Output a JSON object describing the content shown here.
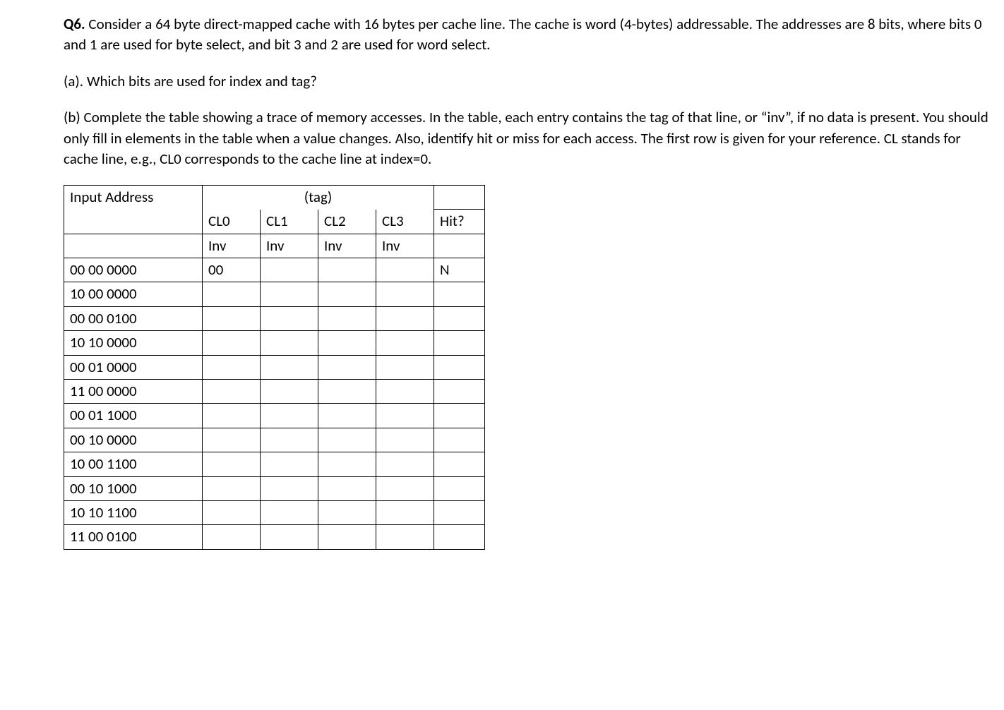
{
  "question": {
    "label": "Q6.",
    "intro": "Consider a 64 byte direct-mapped cache with 16 bytes per cache line. The cache is word (4-bytes) addressable. The addresses are 8 bits, where bits 0 and 1 are used for byte select, and bit 3 and 2 are used for word select.",
    "part_a": "(a). Which bits are used for index and tag?",
    "part_b": "(b) Complete the table showing a trace of memory accesses. In the table, each entry contains the tag of that line, or “inv”, if no data is present. You should only fill in elements in the table when a value changes. Also, identify hit or miss for each access. The first row is given for your reference. CL stands for cache line, e.g., CL0 corresponds to the cache line at index=0."
  },
  "table": {
    "header": {
      "input_address": "Input Address",
      "tag_label": "(tag)",
      "cl0": "CL0",
      "cl1": "CL1",
      "cl2": "CL2",
      "cl3": "CL3",
      "hit": "Hit?"
    },
    "initial": {
      "cl0": "Inv",
      "cl1": "Inv",
      "cl2": "Inv",
      "cl3": "Inv",
      "hit": ""
    },
    "rows": [
      {
        "addr": "00 00 0000",
        "cl0": "00",
        "cl1": "",
        "cl2": "",
        "cl3": "",
        "hit": "N"
      },
      {
        "addr": "10 00 0000",
        "cl0": "",
        "cl1": "",
        "cl2": "",
        "cl3": "",
        "hit": ""
      },
      {
        "addr": "00 00 0100",
        "cl0": "",
        "cl1": "",
        "cl2": "",
        "cl3": "",
        "hit": ""
      },
      {
        "addr": "10 10 0000",
        "cl0": "",
        "cl1": "",
        "cl2": "",
        "cl3": "",
        "hit": ""
      },
      {
        "addr": "00 01 0000",
        "cl0": "",
        "cl1": "",
        "cl2": "",
        "cl3": "",
        "hit": ""
      },
      {
        "addr": "11 00 0000",
        "cl0": "",
        "cl1": "",
        "cl2": "",
        "cl3": "",
        "hit": ""
      },
      {
        "addr": "00 01 1000",
        "cl0": "",
        "cl1": "",
        "cl2": "",
        "cl3": "",
        "hit": ""
      },
      {
        "addr": "00 10 0000",
        "cl0": "",
        "cl1": "",
        "cl2": "",
        "cl3": "",
        "hit": ""
      },
      {
        "addr": "10 00 1100",
        "cl0": "",
        "cl1": "",
        "cl2": "",
        "cl3": "",
        "hit": ""
      },
      {
        "addr": "00 10 1000",
        "cl0": "",
        "cl1": "",
        "cl2": "",
        "cl3": "",
        "hit": ""
      },
      {
        "addr": "10 10 1100",
        "cl0": "",
        "cl1": "",
        "cl2": "",
        "cl3": "",
        "hit": ""
      },
      {
        "addr": "11 00 0100",
        "cl0": "",
        "cl1": "",
        "cl2": "",
        "cl3": "",
        "hit": ""
      }
    ]
  }
}
